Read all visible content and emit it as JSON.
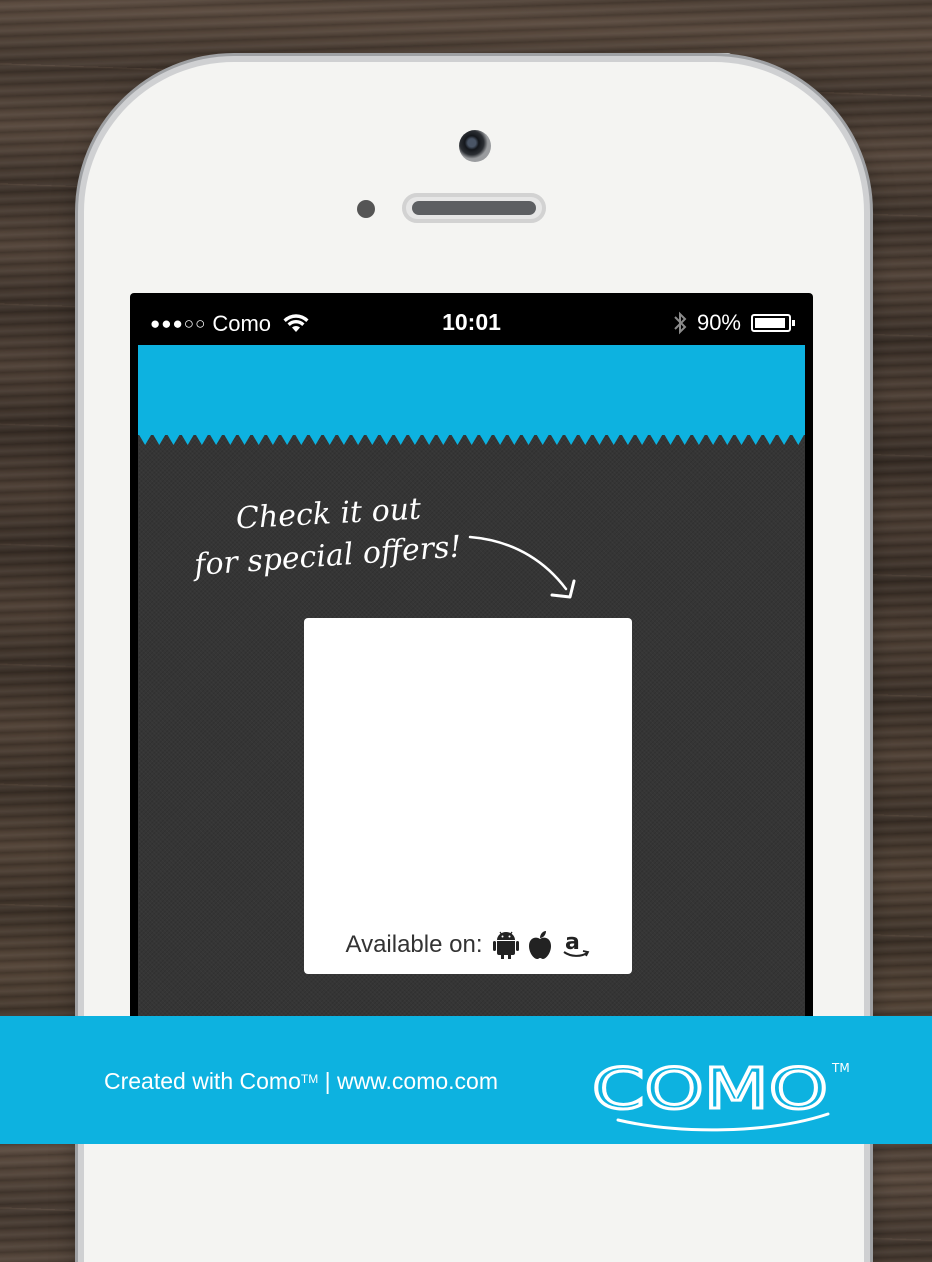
{
  "status_bar": {
    "signal": "●●●○○",
    "carrier": "Como",
    "time": "10:01",
    "battery_percent": "90%",
    "battery_level": 0.9
  },
  "banner": {
    "handwritten_line1": "Check it out",
    "handwritten_line2": "for special offers!"
  },
  "store_card": {
    "available_label": "Available on:",
    "icons": [
      "android-icon",
      "apple-icon",
      "amazon-icon"
    ]
  },
  "footer": {
    "created_prefix": "Created with Como",
    "tm": "TM",
    "separator": " | ",
    "url": "www.como.com",
    "logo_text": "COMO",
    "logo_tm": "TM"
  },
  "colors": {
    "accent": "#0db2e0",
    "app_background": "#353535",
    "phone_body": "#f4f4f2"
  }
}
